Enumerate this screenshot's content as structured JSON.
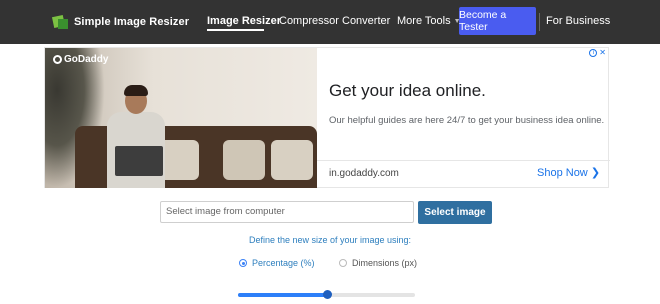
{
  "header": {
    "brand": "Simple Image Resizer",
    "nav": [
      {
        "label": "Image Resizer",
        "active": true
      },
      {
        "label": "Compressor"
      },
      {
        "label": "Converter"
      },
      {
        "label": "More Tools"
      }
    ],
    "cta_label": "Become a Tester",
    "business_label": "For Business"
  },
  "ad": {
    "logo_text": "GoDaddy",
    "headline": "Get your idea online.",
    "body": "Our helpful guides are here 24/7 to get your business idea online.",
    "domain": "in.godaddy.com",
    "cta": "Shop Now"
  },
  "uploader": {
    "placeholder": "Select image from computer",
    "button_label": "Select image",
    "instruction": "Define the new size of your image using:",
    "options": [
      {
        "label": "Percentage (%)",
        "checked": true
      },
      {
        "label": "Dimensions (px)",
        "checked": false
      }
    ],
    "slider_fraction": 0.5
  },
  "colors": {
    "nav_bg": "#333333",
    "accent": "#4a5cf0",
    "button": "#2f6fa0",
    "link": "#1a73e8"
  }
}
